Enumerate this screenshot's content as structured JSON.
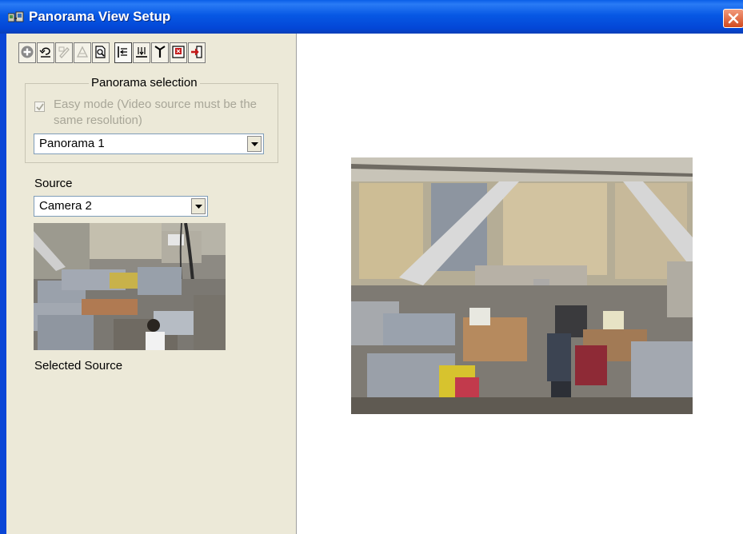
{
  "window": {
    "title": "Panorama View Setup",
    "app_icon": "panorama-app-icon",
    "close_icon": "close-icon"
  },
  "toolbar": {
    "buttons": [
      {
        "icon": "add-icon",
        "enabled": true,
        "pressed": false
      },
      {
        "icon": "undo-icon",
        "enabled": true,
        "pressed": false
      },
      {
        "icon": "edit-icon",
        "enabled": false,
        "pressed": false
      },
      {
        "icon": "clear-icon",
        "enabled": false,
        "pressed": false
      },
      {
        "icon": "preview-icon",
        "enabled": true,
        "pressed": false
      },
      {
        "icon": "align-horizontal-icon",
        "enabled": true,
        "pressed": true
      },
      {
        "icon": "align-vertical-icon",
        "enabled": true,
        "pressed": false
      },
      {
        "icon": "split-icon",
        "enabled": true,
        "pressed": false
      },
      {
        "icon": "save-icon",
        "enabled": true,
        "pressed": false
      },
      {
        "icon": "exit-icon",
        "enabled": true,
        "pressed": false
      }
    ]
  },
  "panorama_selection": {
    "legend": "Panorama selection",
    "easy_mode_label": "Easy mode (Video source must be the same resolution)",
    "easy_mode_checked": true,
    "easy_mode_enabled": false,
    "selected": "Panorama 1"
  },
  "source": {
    "label": "Source",
    "selected": "Camera 2",
    "selected_source_label": "Selected Source"
  },
  "colors": {
    "titlebar": "#0758e4",
    "face": "#ece9d8",
    "close": "#d24a1f"
  }
}
